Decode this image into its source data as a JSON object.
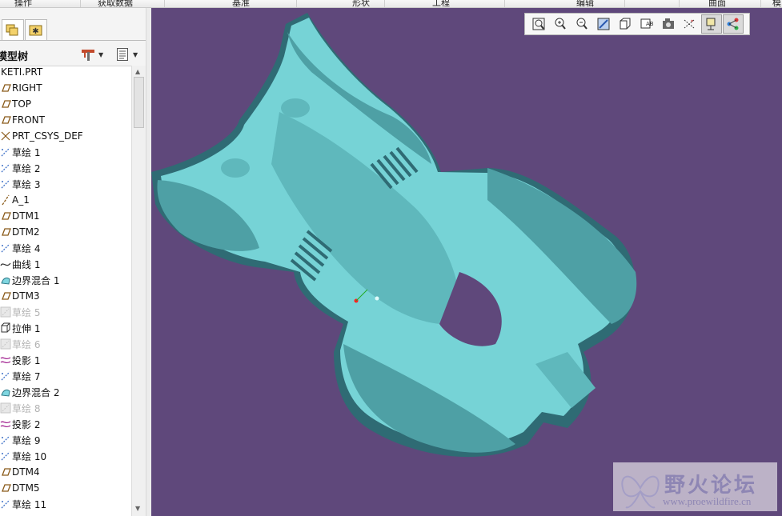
{
  "ribbon": {
    "tabs": [
      "操作",
      "获取数据",
      "基准",
      "形状",
      "工程",
      "编辑",
      "曲面",
      "模"
    ]
  },
  "panel": {
    "tabs": [
      {
        "icon": "layers-icon",
        "active": true
      },
      {
        "icon": "star-folder-icon",
        "active": false
      }
    ],
    "title": "模型树"
  },
  "tree": {
    "items": [
      {
        "label": "KETI.PRT",
        "icon": "part-icon",
        "dim": false
      },
      {
        "label": "RIGHT",
        "icon": "datum-plane-icon",
        "dim": false
      },
      {
        "label": "TOP",
        "icon": "datum-plane-icon",
        "dim": false
      },
      {
        "label": "FRONT",
        "icon": "datum-plane-icon",
        "dim": false
      },
      {
        "label": "PRT_CSYS_DEF",
        "icon": "csys-icon",
        "dim": false
      },
      {
        "label": "草绘 1",
        "icon": "sketch-icon",
        "dim": false
      },
      {
        "label": "草绘 2",
        "icon": "sketch-icon",
        "dim": false
      },
      {
        "label": "草绘 3",
        "icon": "sketch-icon",
        "dim": false
      },
      {
        "label": "A_1",
        "icon": "axis-icon",
        "dim": false
      },
      {
        "label": "DTM1",
        "icon": "datum-plane-icon",
        "dim": false
      },
      {
        "label": "DTM2",
        "icon": "datum-plane-icon",
        "dim": false
      },
      {
        "label": "草绘 4",
        "icon": "sketch-icon",
        "dim": false
      },
      {
        "label": "曲线 1",
        "icon": "curve-icon",
        "dim": false
      },
      {
        "label": "边界混合 1",
        "icon": "boundary-blend-icon",
        "dim": false
      },
      {
        "label": "DTM3",
        "icon": "datum-plane-icon",
        "dim": false
      },
      {
        "label": "草绘 5",
        "icon": "sketch-icon",
        "dim": true
      },
      {
        "label": "拉伸 1",
        "icon": "extrude-icon",
        "dim": false
      },
      {
        "label": "草绘 6",
        "icon": "sketch-icon",
        "dim": true
      },
      {
        "label": "投影 1",
        "icon": "projection-icon",
        "dim": false
      },
      {
        "label": "草绘 7",
        "icon": "sketch-icon",
        "dim": false
      },
      {
        "label": "边界混合 2",
        "icon": "boundary-blend-icon",
        "dim": false
      },
      {
        "label": "草绘 8",
        "icon": "sketch-icon",
        "dim": true
      },
      {
        "label": "投影 2",
        "icon": "projection-icon",
        "dim": false
      },
      {
        "label": "草绘 9",
        "icon": "sketch-icon",
        "dim": false
      },
      {
        "label": "草绘 10",
        "icon": "sketch-icon",
        "dim": false
      },
      {
        "label": "DTM4",
        "icon": "datum-plane-icon",
        "dim": false
      },
      {
        "label": "DTM5",
        "icon": "datum-plane-icon",
        "dim": false
      },
      {
        "label": "草绘 11",
        "icon": "sketch-icon",
        "dim": false
      }
    ]
  },
  "view_toolbar": {
    "buttons": [
      {
        "icon": "refit-icon",
        "on": false
      },
      {
        "icon": "zoom-in-icon",
        "on": false
      },
      {
        "icon": "zoom-out-icon",
        "on": false
      },
      {
        "icon": "repaint-icon",
        "on": false
      },
      {
        "icon": "display-style-icon",
        "on": false
      },
      {
        "icon": "saved-views-icon",
        "on": false
      },
      {
        "icon": "view-manager-icon",
        "on": false
      },
      {
        "icon": "datum-display-icon",
        "on": false
      },
      {
        "icon": "annotation-display-icon",
        "on": true
      },
      {
        "icon": "spin-center-icon",
        "on": true
      }
    ]
  },
  "watermark": {
    "title": "野火论坛",
    "url": "www.proewildfire.cn"
  },
  "colors": {
    "viewport_bg": "#5f487b",
    "model_face": "#76d3d6",
    "model_shadow": "#2f6b74",
    "accent": "#3f72c8"
  }
}
